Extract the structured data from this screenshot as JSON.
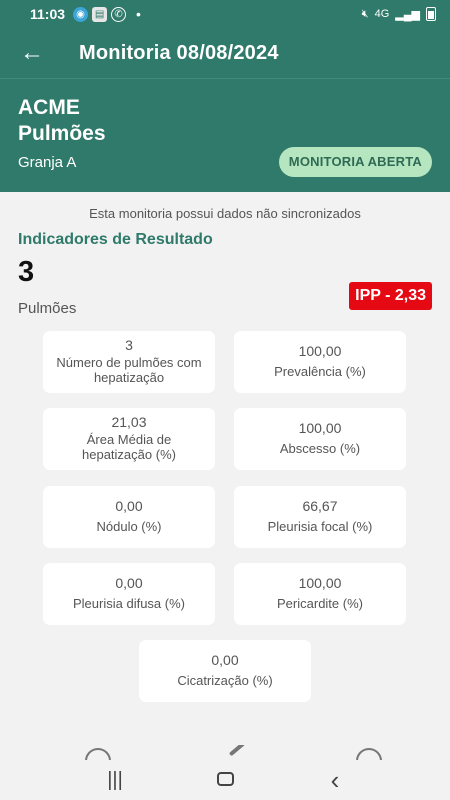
{
  "status_bar": {
    "time": "11:03",
    "dot": "•",
    "network": "4G"
  },
  "app_bar": {
    "back_icon": "arrow-left-icon",
    "title": "Monitoria 08/08/2024"
  },
  "header": {
    "company": "ACME",
    "organ": "Pulmões",
    "farm": "Granja A",
    "status_chip": "MONITORIA ABERTA"
  },
  "sync_message": "Esta monitoria possui dados não sincronizados",
  "section_title": "Indicadores de Resultado",
  "summary": {
    "count": "3",
    "count_label": "Pulmões",
    "ipp": "IPP -  2,33"
  },
  "indicators": [
    {
      "value": "3",
      "label": "Número de pulmões com hepatização"
    },
    {
      "value": "100,00",
      "label": "Prevalência (%)"
    },
    {
      "value": "21,03",
      "label": "Área Média de hepatização (%)"
    },
    {
      "value": "100,00",
      "label": "Abscesso (%)"
    },
    {
      "value": "0,00",
      "label": "Nódulo (%)"
    },
    {
      "value": "66,67",
      "label": "Pleurisia focal (%)"
    },
    {
      "value": "0,00",
      "label": "Pleurisia difusa (%)"
    },
    {
      "value": "100,00",
      "label": "Pericardite (%)"
    },
    {
      "value": "0,00",
      "label": "Cicatrização (%)"
    }
  ],
  "colors": {
    "primary": "#2f7a6a",
    "chip_bg": "#b6e6bf",
    "ipp_bg": "#e50914"
  },
  "system_nav": {
    "recents": "|||",
    "back": "‹"
  }
}
